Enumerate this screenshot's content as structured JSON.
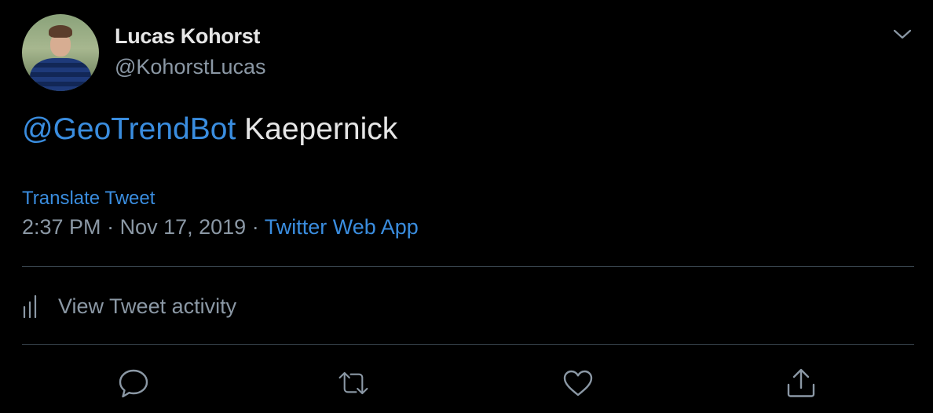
{
  "tweet": {
    "author_name": "Lucas Kohorst",
    "author_handle": "@KohorstLucas",
    "mention": "@GeoTrendBot",
    "body": " Kaepernick",
    "translate_label": "Translate Tweet",
    "time": "2:37 PM",
    "separator1": " · ",
    "date": "Nov 17, 2019",
    "separator2": " · ",
    "source": "Twitter Web App",
    "activity_label": "View Tweet activity"
  },
  "colors": {
    "background": "#000000",
    "link": "#3a8ddf",
    "secondary_text": "#8b98a5",
    "primary_text": "#e6e6e6",
    "divider": "#38444d"
  },
  "icons": {
    "more": "chevron-down-icon",
    "activity": "bar-chart-icon",
    "reply": "reply-icon",
    "retweet": "retweet-icon",
    "like": "heart-icon",
    "share": "share-icon"
  }
}
